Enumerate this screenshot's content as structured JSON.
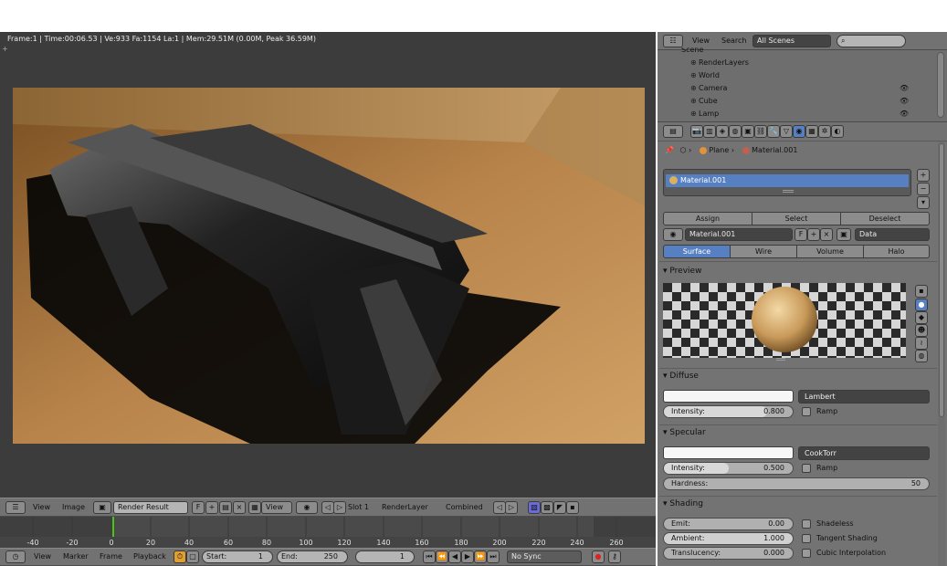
{
  "render_info": "Frame:1 | Time:00:06.53 | Ve:933 Fa:1154 La:1 | Mem:29.51M (0.00M, Peak 36.59M)",
  "image_editor": {
    "view": "View",
    "image": "Image",
    "image_name": "Render Result",
    "f_label": "F",
    "view_dropdown": "View",
    "slot": "Slot 1",
    "layer": "RenderLayer",
    "pass": "Combined"
  },
  "timeline": {
    "ticks": [
      "-40",
      "-20",
      "0",
      "20",
      "40",
      "60",
      "80",
      "100",
      "120",
      "140",
      "160",
      "180",
      "200",
      "220",
      "240",
      "260"
    ],
    "current_frame": "1",
    "view": "View",
    "marker": "Marker",
    "frame": "Frame",
    "playback": "Playback",
    "start_label": "Start:",
    "start_value": "1",
    "end_label": "End:",
    "end_value": "250",
    "frame_value": "1",
    "sync": "No Sync"
  },
  "outliner": {
    "view": "View",
    "search": "Search",
    "scenes": "All Scenes",
    "items": [
      {
        "label": "Scene"
      },
      {
        "label": "RenderLayers"
      },
      {
        "label": "World"
      },
      {
        "label": "Camera"
      },
      {
        "label": "Cube"
      },
      {
        "label": "Lamp"
      }
    ]
  },
  "properties": {
    "breadcrumb_object": "Plane",
    "breadcrumb_material": "Material.001",
    "slot_name": "Material.001",
    "assign": "Assign",
    "select": "Select",
    "deselect": "Deselect",
    "material_name": "Material.001",
    "f_label": "F",
    "data_label": "Data",
    "tabs": [
      "Surface",
      "Wire",
      "Volume",
      "Halo"
    ],
    "active_tab": "Surface",
    "preview_title": "Preview",
    "diffuse_title": "Diffuse",
    "diffuse_shader": "Lambert",
    "diffuse_intensity_label": "Intensity:",
    "diffuse_intensity": "0.800",
    "diffuse_intensity_frac": 0.8,
    "ramp": "Ramp",
    "specular_title": "Specular",
    "specular_shader": "CookTorr",
    "specular_intensity_label": "Intensity:",
    "specular_intensity": "0.500",
    "specular_intensity_frac": 0.5,
    "hardness_label": "Hardness:",
    "hardness": "50",
    "shading_title": "Shading",
    "emit_label": "Emit:",
    "emit": "0.00",
    "ambient_label": "Ambient:",
    "ambient": "1.000",
    "translucency_label": "Translucency:",
    "translucency": "0.000",
    "shadeless": "Shadeless",
    "tangent_shading": "Tangent Shading",
    "cubic_interpolation": "Cubic Interpolation"
  },
  "colors": {
    "accent": "#5680c2",
    "panel": "#737373",
    "current_frame": "#4cc417"
  }
}
